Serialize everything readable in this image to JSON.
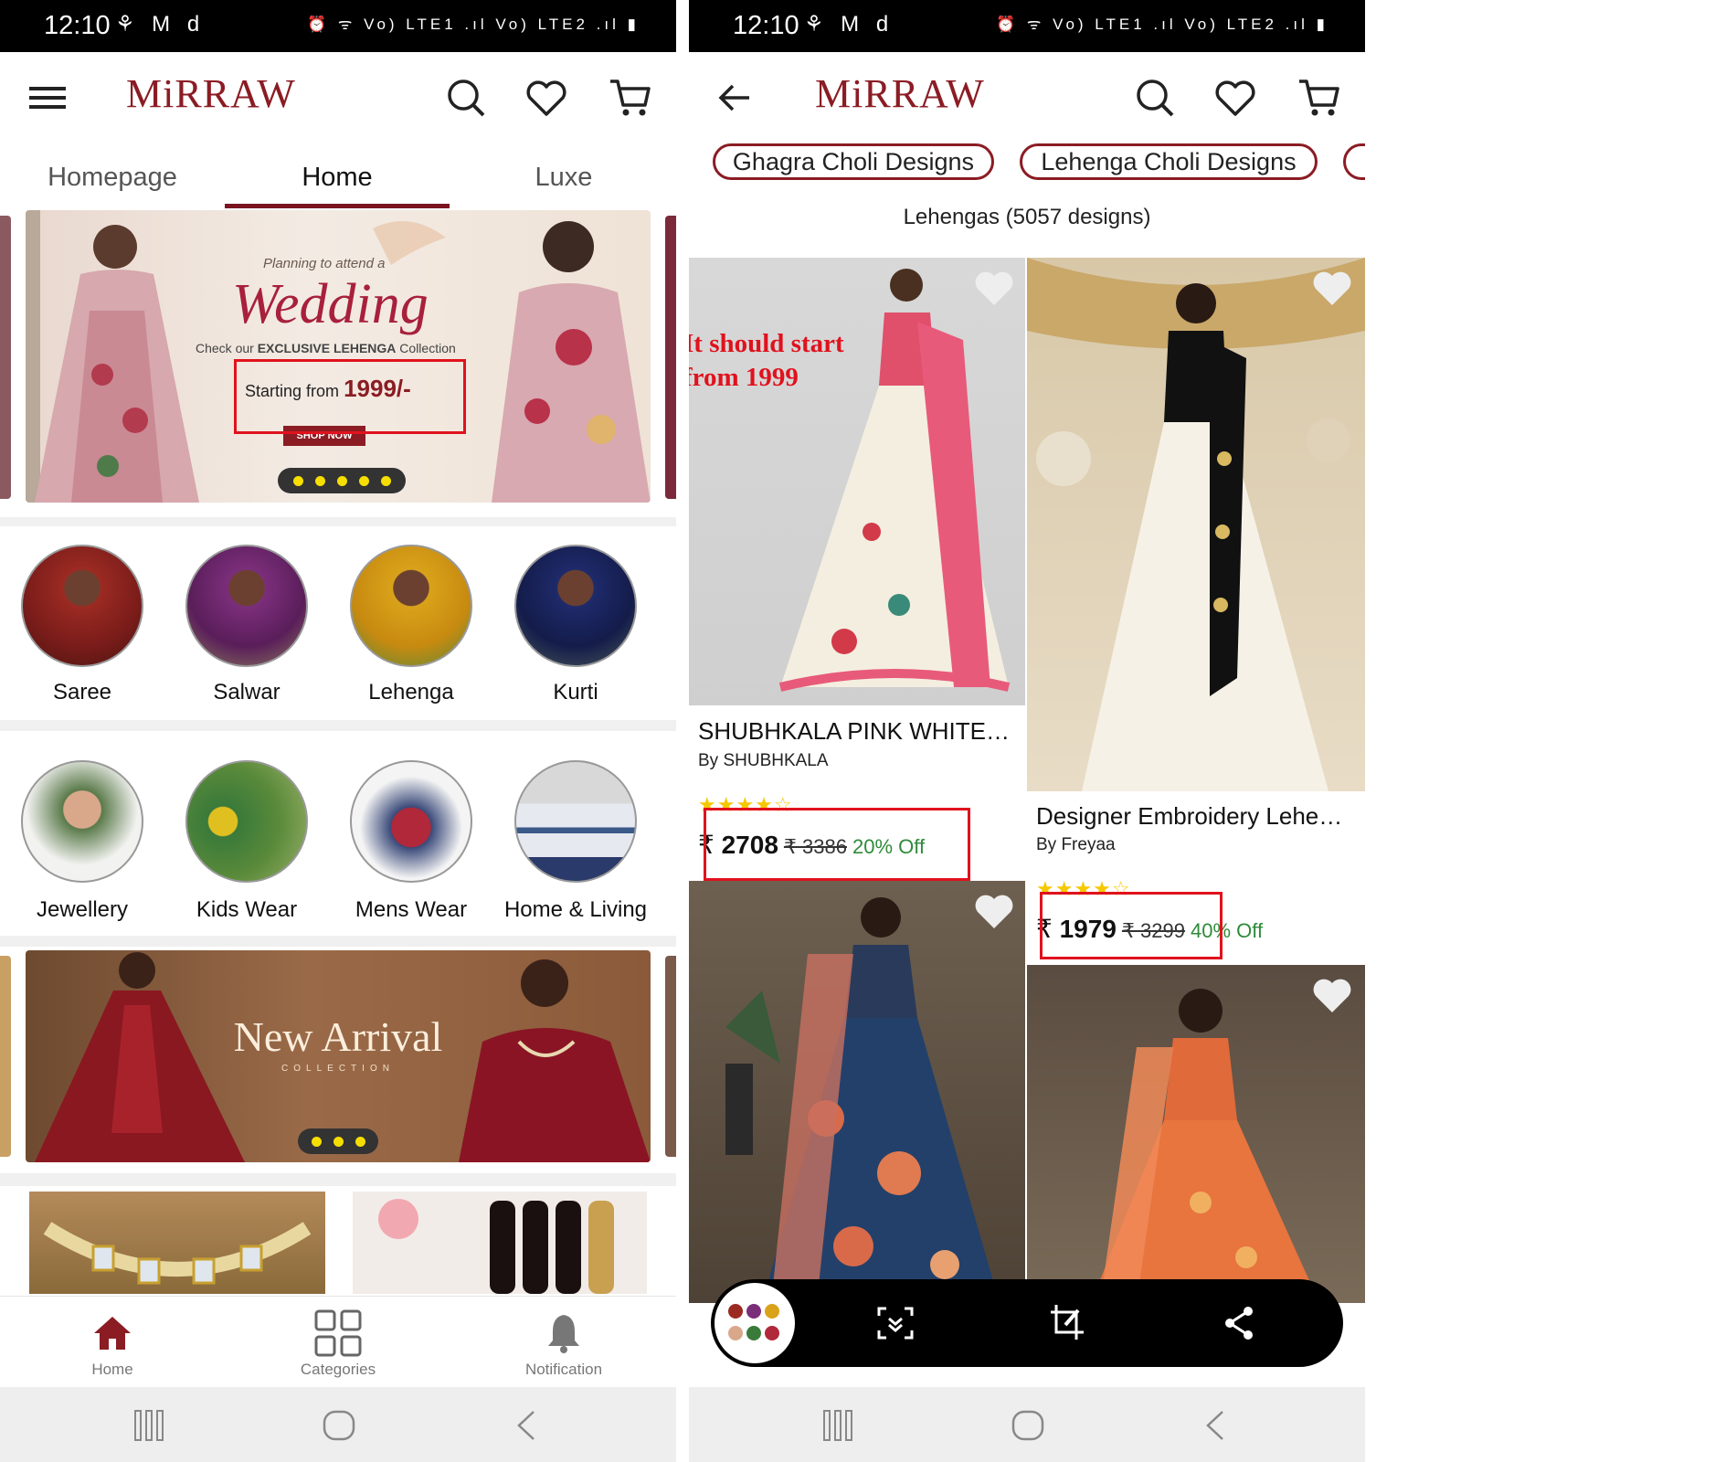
{
  "status_bar": {
    "time": "12:10",
    "notif_icons": "⚘ M d",
    "system_icons": "⏰ ᯤ Vo) LTE1 .ıl Vo) LTE2 .ıl ▮"
  },
  "brand": {
    "logo": "MiRRAW",
    "primary_color": "#8b1c24",
    "accent_color": "#e0121d"
  },
  "left": {
    "tabs": [
      {
        "label": "Homepage",
        "active": false
      },
      {
        "label": "Home",
        "active": true
      },
      {
        "label": "Luxe",
        "active": false
      }
    ],
    "hero_banner": {
      "eyebrow": "Planning to attend a",
      "headline": "Wedding",
      "subline_prefix": "Check our",
      "subline_bold": "EXCLUSIVE LEHENGA",
      "subline_suffix": "Collection",
      "price_prefix": "Starting from",
      "price_value": "1999/-",
      "cta": "SHOP NOW"
    },
    "categories_row1": [
      {
        "label": "Saree"
      },
      {
        "label": "Salwar"
      },
      {
        "label": "Lehenga"
      },
      {
        "label": "Kurti"
      }
    ],
    "categories_row2": [
      {
        "label": "Jewellery"
      },
      {
        "label": "Kids Wear"
      },
      {
        "label": "Mens Wear"
      },
      {
        "label": "Home & Living"
      }
    ],
    "new_arrival_banner": {
      "title": "New Arrival",
      "subtitle": "COLLECTION"
    },
    "bottom_nav": [
      {
        "label": "Home",
        "icon": "home-icon"
      },
      {
        "label": "Categories",
        "icon": "grid-icon"
      },
      {
        "label": "Notification",
        "icon": "bell-icon"
      }
    ]
  },
  "right": {
    "chips": [
      "Ghagra Choli Designs",
      "Lehenga Choli Designs"
    ],
    "result_count": "Lehengas (5057 designs)",
    "annotation": {
      "line1": "It should start",
      "line2": "from 1999"
    },
    "products": [
      {
        "title": "SHUBHKALA PINK WHITE…",
        "brand": "By SHUBHKALA",
        "rating": 4,
        "currency": "₹",
        "price": "2708",
        "mrp": "₹ 3386",
        "discount": "20% Off"
      },
      {
        "title": "Designer Embroidery Lehe…",
        "brand": "By Freyaa",
        "rating": 4,
        "currency": "₹",
        "price": "1979",
        "mrp": "₹ 3299",
        "discount": "40% Off"
      }
    ]
  }
}
